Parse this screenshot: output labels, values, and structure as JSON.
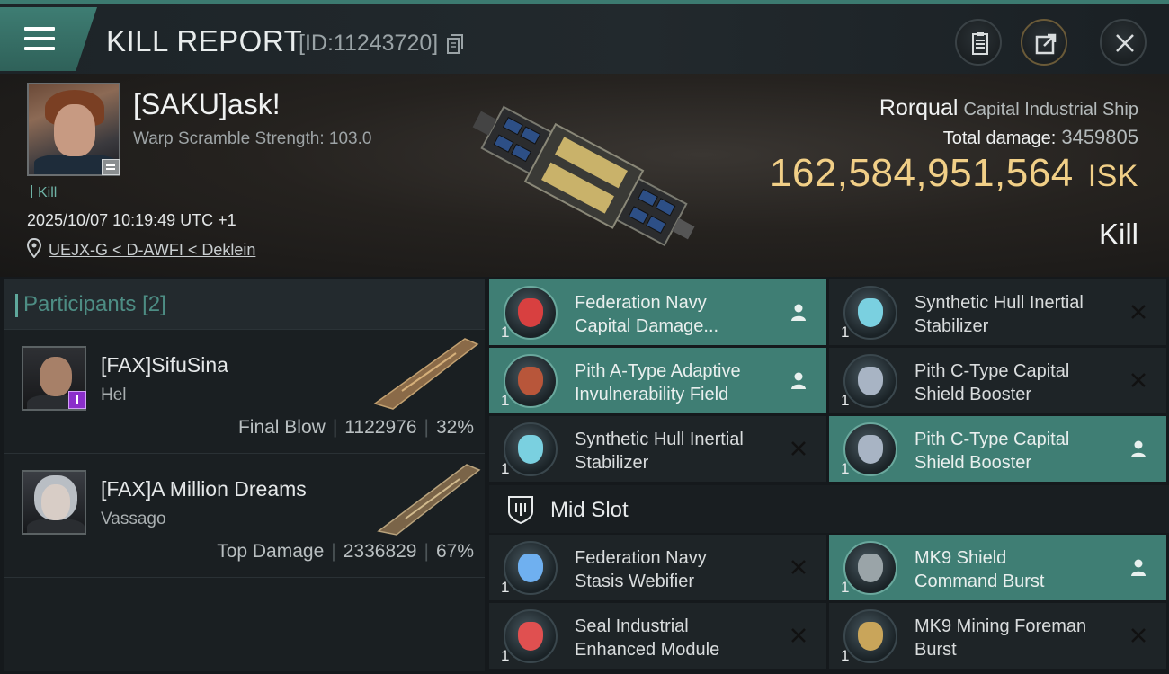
{
  "header": {
    "title": "KILL REPORT",
    "id_text": "[ID:11243720]"
  },
  "victim": {
    "name": "[SAKU]ask!",
    "warp_scramble": "Warp Scramble Strength: 103.0",
    "kill_tag": "Kill",
    "datetime": "2025/10/07 10:19:49 UTC +1",
    "location": "UEJX-G < D-AWFI < Deklein",
    "ship_name": "Rorqual",
    "ship_class": "Capital Industrial Ship",
    "total_damage_label": "Total damage:",
    "total_damage_value": "3459805",
    "isk_value": "162,584,951,564",
    "isk_unit": "ISK",
    "result": "Kill"
  },
  "participants": {
    "label": "Participants",
    "count": "[2]",
    "rows": [
      {
        "name": "[FAX]SifuSina",
        "ship": "Hel",
        "role": "Final Blow",
        "damage": "1122976",
        "percent": "32%"
      },
      {
        "name": "[FAX]A Million Dreams",
        "ship": "Vassago",
        "role": "Top Damage",
        "damage": "2336829",
        "percent": "67%"
      }
    ]
  },
  "slots": {
    "items": [
      {
        "name_line1": "Federation Navy",
        "name_line2": "Capital Damage...",
        "qty": "1",
        "highlight": true,
        "action": "pilot-icon",
        "icon_color": "#d84040"
      },
      {
        "name_line1": "Synthetic Hull Inertial",
        "name_line2": "Stabilizer",
        "qty": "1",
        "highlight": false,
        "action": "close-icon",
        "icon_color": "#7ad0e0"
      },
      {
        "name_line1": "Pith A-Type Adaptive",
        "name_line2": "Invulnerability Field",
        "qty": "1",
        "highlight": true,
        "action": "pilot-icon",
        "icon_color": "#b8563a"
      },
      {
        "name_line1": "Pith C-Type Capital",
        "name_line2": "Shield Booster",
        "qty": "1",
        "highlight": false,
        "action": "close-icon",
        "icon_color": "#a8b4c4"
      },
      {
        "name_line1": "Synthetic Hull Inertial",
        "name_line2": "Stabilizer",
        "qty": "1",
        "highlight": false,
        "action": "close-icon",
        "icon_color": "#7ad0e0"
      },
      {
        "name_line1": "Pith C-Type Capital",
        "name_line2": "Shield Booster",
        "qty": "1",
        "highlight": true,
        "action": "pilot-icon",
        "icon_color": "#a8b4c4"
      }
    ],
    "mid_slot_label": "Mid Slot",
    "mid_items": [
      {
        "name_line1": "Federation Navy",
        "name_line2": "Stasis Webifier",
        "qty": "1",
        "highlight": false,
        "action": "close-icon",
        "icon_color": "#6fb0f0"
      },
      {
        "name_line1": "MK9 Shield",
        "name_line2": "Command Burst",
        "qty": "1",
        "highlight": true,
        "action": "pilot-icon",
        "icon_color": "#9aa4a8"
      },
      {
        "name_line1": "Seal Industrial",
        "name_line2": "Enhanced Module",
        "qty": "1",
        "highlight": false,
        "action": "close-icon",
        "icon_color": "#e05050"
      },
      {
        "name_line1": "MK9 Mining Foreman",
        "name_line2": "Burst",
        "qty": "1",
        "highlight": false,
        "action": "close-icon",
        "icon_color": "#c9a55a"
      }
    ]
  },
  "colors": {
    "accent": "#3f7e74",
    "isk": "#f1cf87",
    "bg": "#15191c"
  }
}
